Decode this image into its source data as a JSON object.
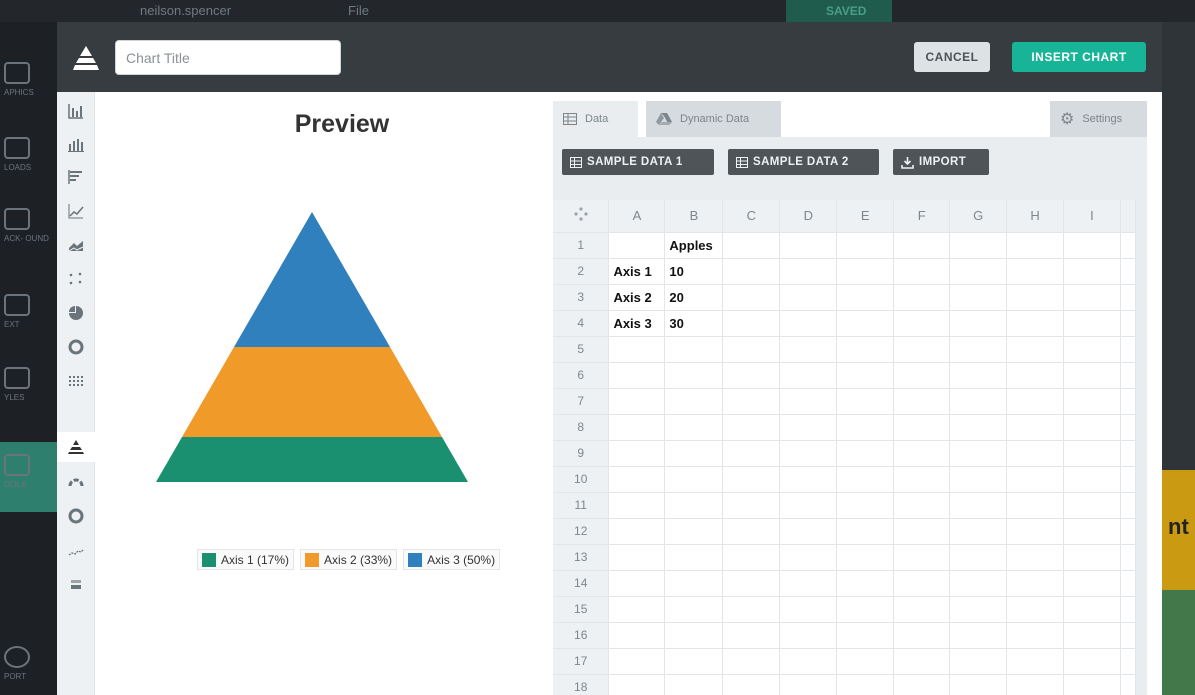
{
  "background": {
    "user_name": "neilson.spencer",
    "file_menu": "File",
    "saved_label": "SAVED",
    "left_items": [
      "APHICS",
      "LOADS",
      "ACK-\nOUND",
      "EXT",
      "YLES",
      "OOLS",
      "PORT"
    ],
    "right_fragment": "nt"
  },
  "header": {
    "title_placeholder": "Chart Title",
    "title_value": "",
    "cancel_label": "CANCEL",
    "insert_label": "INSERT CHART"
  },
  "chart_types": [
    {
      "name": "column",
      "icon": "column-chart-icon"
    },
    {
      "name": "stacked-column",
      "icon": "stacked-column-chart-icon"
    },
    {
      "name": "bar",
      "icon": "bar-chart-icon"
    },
    {
      "name": "line",
      "icon": "line-chart-icon"
    },
    {
      "name": "area",
      "icon": "area-chart-icon"
    },
    {
      "name": "scatter",
      "icon": "scatter-chart-icon"
    },
    {
      "name": "pie",
      "icon": "pie-chart-icon"
    },
    {
      "name": "donut",
      "icon": "donut-chart-icon"
    },
    {
      "name": "grid",
      "icon": "dot-grid-chart-icon"
    },
    {
      "name": "pyramid",
      "icon": "pyramid-chart-icon",
      "active": true
    },
    {
      "name": "gauge",
      "icon": "gauge-chart-icon"
    },
    {
      "name": "ring",
      "icon": "ring-chart-icon"
    },
    {
      "name": "sparkline",
      "icon": "sparkline-chart-icon"
    },
    {
      "name": "number",
      "icon": "number-chart-icon"
    }
  ],
  "preview": {
    "title": "Preview"
  },
  "chart_data": {
    "type": "pyramid",
    "categories": [
      "Axis 1",
      "Axis 2",
      "Axis 3"
    ],
    "values": [
      10,
      20,
      30
    ],
    "series_name": "Apples",
    "colors": [
      "#1a9070",
      "#f09a2a",
      "#2f80bc"
    ],
    "legend": [
      "Axis 1 (17%)",
      "Axis 2 (33%)",
      "Axis 3 (50%)"
    ],
    "legend_position": "bottom"
  },
  "data_panel": {
    "tabs": {
      "data": "Data",
      "dynamic": "Dynamic Data",
      "settings": "Settings"
    },
    "buttons": {
      "sample1": "SAMPLE DATA 1",
      "sample2": "SAMPLE DATA 2",
      "import": "IMPORT"
    },
    "columns": [
      "A",
      "B",
      "C",
      "D",
      "E",
      "F",
      "G",
      "H",
      "I"
    ],
    "rows": [
      "1",
      "2",
      "3",
      "4",
      "5",
      "6",
      "7",
      "8",
      "9",
      "10",
      "11",
      "12",
      "13",
      "14",
      "15",
      "16",
      "17",
      "18"
    ],
    "cells": [
      [
        "",
        "Apples"
      ],
      [
        "Axis 1",
        "10"
      ],
      [
        "Axis 2",
        "20"
      ],
      [
        "Axis 3",
        "30"
      ]
    ]
  },
  "colors": {
    "accent": "#18b497",
    "header_bg": "#373c40"
  }
}
